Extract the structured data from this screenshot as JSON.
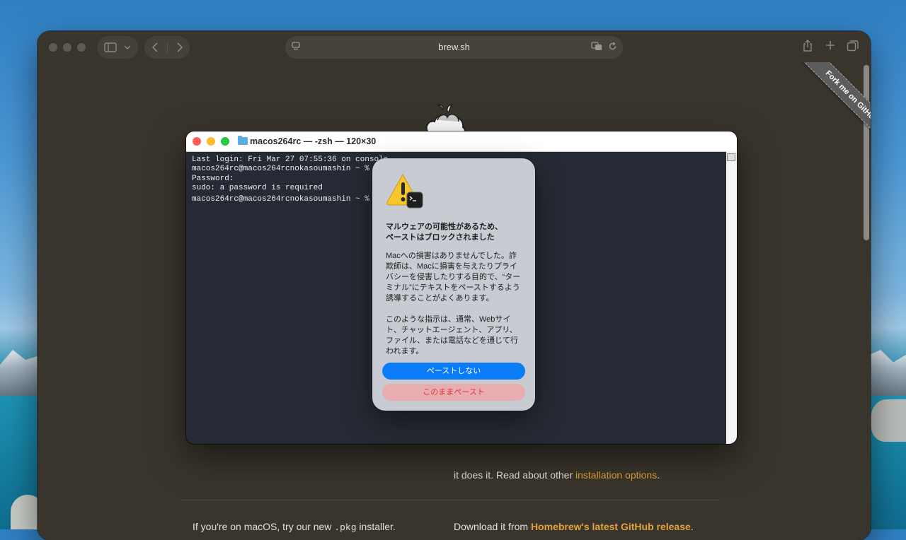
{
  "browser": {
    "url": "brew.sh",
    "ribbon_text": "Fork me on GitHub"
  },
  "page": {
    "partial_line_prefix": "it does it. Read about other ",
    "partial_line_link": "installation options",
    "partial_line_suffix": ".",
    "pkg_prefix": "If you're on macOS, try our new ",
    "pkg_code": ".pkg",
    "pkg_suffix": " installer.",
    "release_prefix": "Download it from ",
    "release_link": "Homebrew's latest GitHub release",
    "release_suffix": "."
  },
  "terminal": {
    "title": "macos264rc — -zsh — 120×30",
    "lines": [
      "Last login: Fri Mar 27 07:55:36 on console",
      "macos264rc@macos264rcnokasoumashin ~ % su",
      "Password:",
      "sudo: a password is required",
      "macos264rc@macos264rcnokasoumashin ~ % "
    ]
  },
  "alert": {
    "title": "マルウェアの可能性があるため、\nペーストはブロックされました",
    "body1": "Macへの損害はありませんでした。詐欺師は、Macに損害を与えたりプライバシーを侵害したりする目的で、“ターミナル”にテキストをペーストするよう誘導することがよくあります。",
    "body2": "このような指示は、通常、Webサイト、チャットエージェント、アプリ、ファイル、または電話などを通じて行われます。",
    "primary_button": "ペーストしない",
    "danger_button": "このままペースト"
  },
  "colors": {
    "accent": "#0a7cf8",
    "danger": "#e5333c",
    "link": "#e2a43b"
  }
}
